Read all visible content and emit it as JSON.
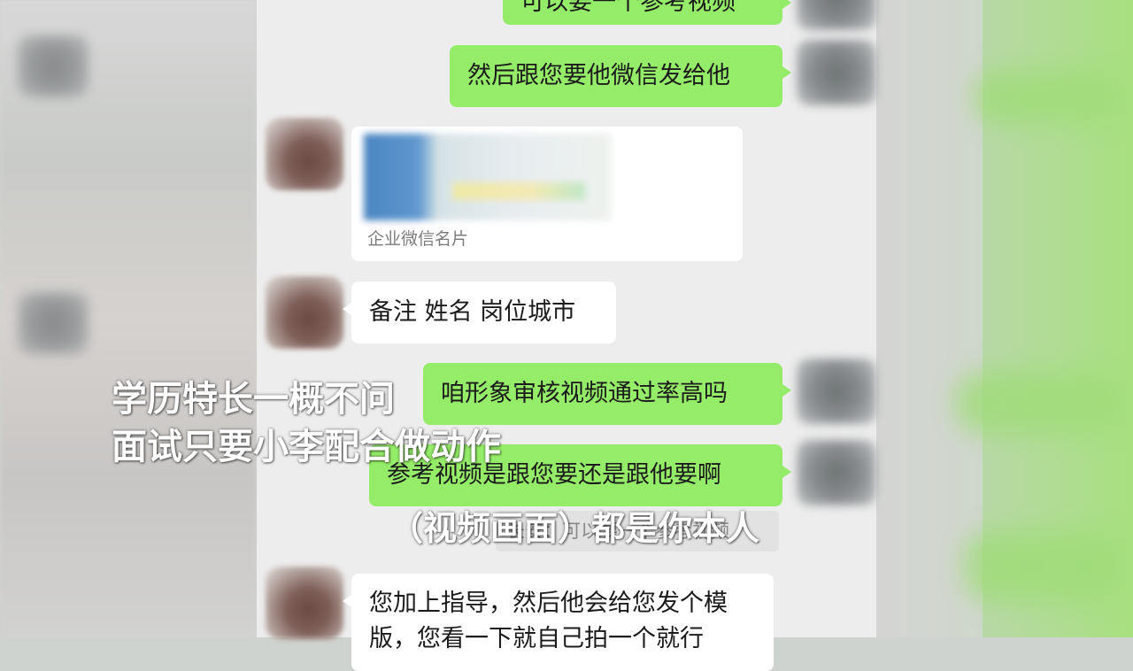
{
  "chat": {
    "messages": [
      {
        "id": "m0",
        "side": "right",
        "text": "可以要一个参考视频"
      },
      {
        "id": "m1",
        "side": "right",
        "text": "然后跟您要他微信发给他"
      },
      {
        "id": "m2",
        "side": "left",
        "type": "card",
        "label": "企业微信名片"
      },
      {
        "id": "m3",
        "side": "left",
        "text": "备注 姓名 岗位城市"
      },
      {
        "id": "m4",
        "side": "right",
        "text": "咱形象审核视频通过率高吗"
      },
      {
        "id": "m5",
        "side": "right",
        "text": "参考视频是跟您要还是跟他要啊"
      },
      {
        "id": "m6",
        "side": "quote",
        "text": "长安：可以要一个参考视频"
      },
      {
        "id": "m7",
        "side": "left",
        "lines": [
          "您加上指导，然后他会给您发个模",
          "版，您看一下就自己拍一个就行"
        ]
      }
    ]
  },
  "captions": {
    "line1": "学历特长一概不问",
    "line2": "面试只要小李配合做动作",
    "line3": "（视频画面）都是你本人"
  },
  "colors": {
    "green_bubble": "#95ec69",
    "chat_bg": "#ededed",
    "white_bubble": "#ffffff"
  }
}
